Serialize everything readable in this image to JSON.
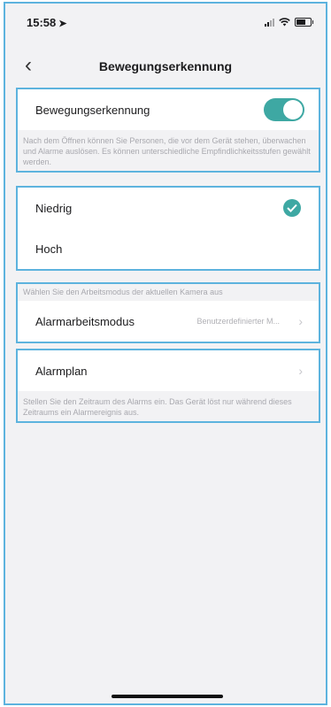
{
  "status": {
    "time": "15:58",
    "location_glyph": "➤"
  },
  "nav": {
    "title": "Bewegungserkennung",
    "back_glyph": "‹"
  },
  "motion": {
    "label": "Bewegungserkennung",
    "enabled": true,
    "description": "Nach dem Öffnen können Sie Personen, die vor dem Gerät stehen, überwachen und Alarme auslösen. Es können unterschiedliche Empfindlichkeitsstufen gewählt werden."
  },
  "sensitivity": {
    "options": [
      {
        "label": "Niedrig",
        "selected": true
      },
      {
        "label": "Hoch",
        "selected": false
      }
    ]
  },
  "alarm_mode": {
    "hint": "Wählen Sie den Arbeitsmodus der aktuellen Kamera aus",
    "label": "Alarmarbeitsmodus",
    "value": "Benutzerdefinierter M...",
    "chevron": "›"
  },
  "alarm_plan": {
    "label": "Alarmplan",
    "chevron": "›",
    "description": "Stellen Sie den Zeitraum des Alarms ein. Das Gerät löst nur während dieses Zeitraums ein Alarmereignis aus."
  },
  "colors": {
    "accent": "#3ea8a3",
    "highlight_border": "#5db3de",
    "background": "#f2f2f4"
  }
}
